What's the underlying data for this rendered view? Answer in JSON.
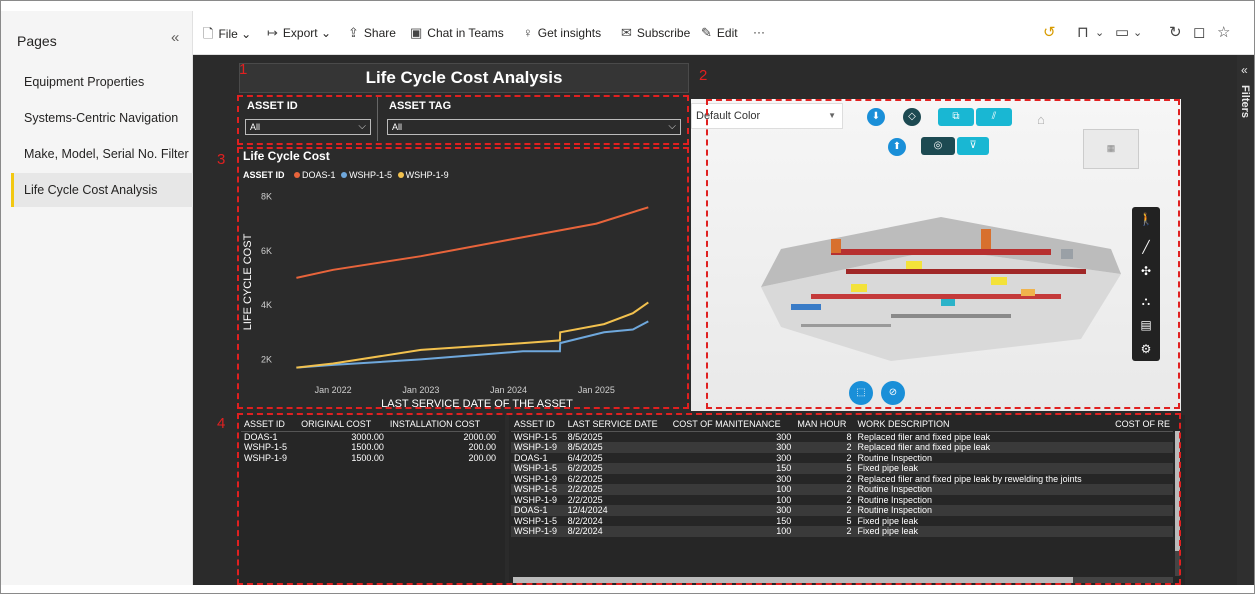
{
  "pages_pane": {
    "title": "Pages",
    "items": [
      {
        "label": "Equipment Properties"
      },
      {
        "label": "Systems-Centric Navigation"
      },
      {
        "label": "Make, Model, Serial No. Filter"
      },
      {
        "label": "Life Cycle Cost Analysis"
      }
    ],
    "active_index": 3
  },
  "toolbar": {
    "file": "File",
    "export": "Export",
    "share": "Share",
    "chat": "Chat in Teams",
    "insights": "Get insights",
    "subscribe": "Subscribe",
    "edit": "Edit",
    "more": "···"
  },
  "report": {
    "title": "Life Cycle Cost Analysis",
    "annotations": [
      "1",
      "2",
      "3",
      "4"
    ],
    "slicers": {
      "asset_id": {
        "label": "ASSET ID",
        "value": "All"
      },
      "asset_tag": {
        "label": "ASSET TAG",
        "value": "All"
      }
    },
    "viewer": {
      "color_dropdown": "Default Color"
    },
    "filters_label": "Filters"
  },
  "chart_data": {
    "type": "line",
    "title": "Life Cycle Cost",
    "legend_title": "ASSET ID",
    "xlabel": "LAST SERVICE DATE OF THE ASSET",
    "ylabel": "LIFE CYCLE COST",
    "x_ticks": [
      "Jan 2022",
      "Jan 2023",
      "Jan 2024",
      "Jan 2025"
    ],
    "y_ticks": [
      "2K",
      "4K",
      "6K",
      "8K"
    ],
    "ylim": [
      1500,
      8200
    ],
    "xlim": [
      "2021-07-01",
      "2025-10-01"
    ],
    "series": [
      {
        "name": "DOAS-1",
        "color": "#e8643b",
        "points": [
          [
            "2021-08-01",
            5000
          ],
          [
            "2022-01-01",
            5300
          ],
          [
            "2023-01-01",
            5800
          ],
          [
            "2024-01-01",
            6400
          ],
          [
            "2025-01-01",
            7000
          ],
          [
            "2025-08-05",
            7600
          ]
        ]
      },
      {
        "name": "WSHP-1-5",
        "color": "#6fa8dc",
        "points": [
          [
            "2021-08-01",
            1700
          ],
          [
            "2022-01-01",
            1800
          ],
          [
            "2023-01-01",
            2000
          ],
          [
            "2024-03-01",
            2300
          ],
          [
            "2024-08-02",
            2300
          ],
          [
            "2024-08-03",
            2600
          ],
          [
            "2025-02-02",
            3000
          ],
          [
            "2025-06-02",
            3100
          ],
          [
            "2025-08-05",
            3400
          ]
        ]
      },
      {
        "name": "WSHP-1-9",
        "color": "#f2c14e",
        "points": [
          [
            "2021-08-01",
            1700
          ],
          [
            "2022-01-01",
            1850
          ],
          [
            "2023-01-01",
            2350
          ],
          [
            "2024-03-01",
            2600
          ],
          [
            "2024-08-02",
            2700
          ],
          [
            "2024-08-03",
            3000
          ],
          [
            "2025-02-02",
            3300
          ],
          [
            "2025-06-02",
            3700
          ],
          [
            "2025-08-05",
            4100
          ]
        ]
      }
    ]
  },
  "cost_table": {
    "headers": [
      "ASSET ID",
      "ORIGINAL COST",
      "INSTALLATION COST"
    ],
    "rows": [
      [
        "DOAS-1",
        "3000.00",
        "2000.00"
      ],
      [
        "WSHP-1-5",
        "1500.00",
        "200.00"
      ],
      [
        "WSHP-1-9",
        "1500.00",
        "200.00"
      ]
    ]
  },
  "maintenance_table": {
    "headers": [
      "ASSET ID",
      "LAST SERVICE DATE",
      "COST OF MANITENANCE",
      "MAN HOUR",
      "WORK DESCRIPTION",
      "COST OF RE"
    ],
    "rows": [
      [
        "WSHP-1-5",
        "8/5/2025",
        "300",
        "8",
        "Replaced filer and fixed pipe leak"
      ],
      [
        "WSHP-1-9",
        "8/5/2025",
        "300",
        "2",
        "Replaced filer and fixed pipe leak"
      ],
      [
        "DOAS-1",
        "6/4/2025",
        "300",
        "2",
        "Routine Inspection"
      ],
      [
        "WSHP-1-5",
        "6/2/2025",
        "150",
        "5",
        "Fixed pipe leak"
      ],
      [
        "WSHP-1-9",
        "6/2/2025",
        "300",
        "2",
        "Replaced filer and fixed pipe leak by rewelding the joints"
      ],
      [
        "WSHP-1-5",
        "2/2/2025",
        "100",
        "2",
        "Routine Inspection"
      ],
      [
        "WSHP-1-9",
        "2/2/2025",
        "100",
        "2",
        "Routine Inspection"
      ],
      [
        "DOAS-1",
        "12/4/2024",
        "300",
        "2",
        "Routine Inspection"
      ],
      [
        "WSHP-1-5",
        "8/2/2024",
        "150",
        "5",
        "Fixed pipe leak"
      ],
      [
        "WSHP-1-9",
        "8/2/2024",
        "100",
        "2",
        "Fixed pipe leak"
      ]
    ]
  }
}
